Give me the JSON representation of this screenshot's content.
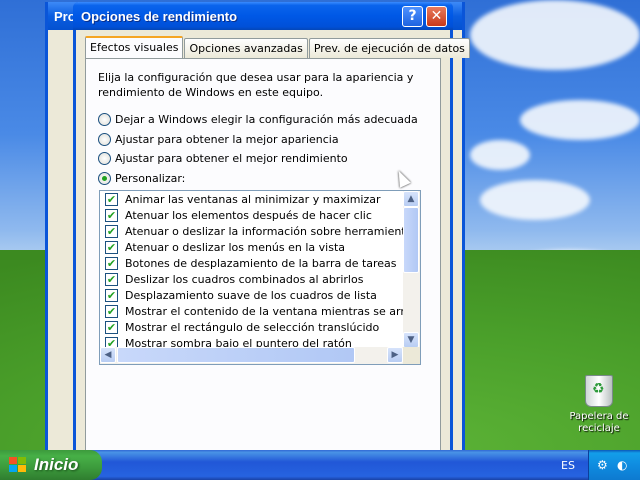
{
  "background_window": {
    "title": "Pro"
  },
  "dialog": {
    "title": "Opciones de rendimiento",
    "help_glyph": "?",
    "close_glyph": "✕",
    "tabs": [
      {
        "label": "Efectos visuales",
        "active": true
      },
      {
        "label": "Opciones avanzadas",
        "active": false
      },
      {
        "label": "Prev. de ejecución de datos",
        "active": false
      }
    ],
    "description": "Elija la configuración que desea usar para la apariencia y rendimiento de Windows en este equipo.",
    "options": [
      {
        "label": "Dejar a Windows elegir la configuración más adecuada",
        "selected": false
      },
      {
        "label": "Ajustar para obtener la mejor apariencia",
        "selected": false
      },
      {
        "label": "Ajustar para obtener el mejor rendimiento",
        "selected": false
      },
      {
        "label": "Personalizar:",
        "selected": true
      }
    ],
    "effects": [
      {
        "label": "Animar las ventanas al minimizar y maximizar",
        "checked": true
      },
      {
        "label": "Atenuar los elementos después de hacer clic",
        "checked": true
      },
      {
        "label": "Atenuar o deslizar la información sobre herramientas en la",
        "checked": true
      },
      {
        "label": "Atenuar o deslizar los menús en la vista",
        "checked": true
      },
      {
        "label": "Botones de desplazamiento de la barra de tareas",
        "checked": true
      },
      {
        "label": "Deslizar los cuadros combinados al abrirlos",
        "checked": true
      },
      {
        "label": "Desplazamiento suave de los cuadros de lista",
        "checked": true
      },
      {
        "label": "Mostrar el contenido de la ventana mientras se arrastra",
        "checked": true
      },
      {
        "label": "Mostrar el rectángulo de selección translúcido",
        "checked": true
      },
      {
        "label": "Mostrar sombra bajo el puntero del ratón",
        "checked": true
      }
    ],
    "check_glyph": "✔"
  },
  "desktop": {
    "recycle_bin_label": "Papelera de reciclaje"
  },
  "taskbar": {
    "start_label": "Inicio",
    "language": "ES"
  }
}
